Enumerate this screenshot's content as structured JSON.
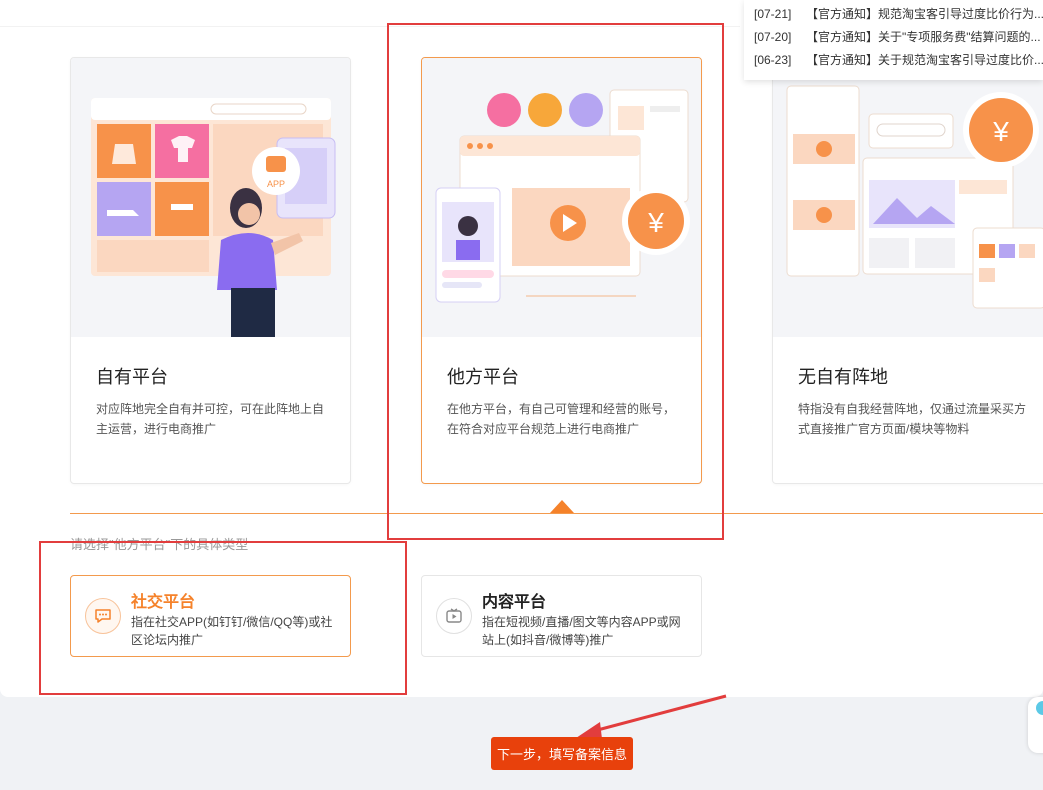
{
  "platforms": [
    {
      "title": "自有平台",
      "desc": "对应阵地完全自有并可控，可在此阵地上自主运营，进行电商推广",
      "selected": false
    },
    {
      "title": "他方平台",
      "desc": "在他方平台，有自己可管理和经营的账号，在符合对应平台规范上进行电商推广",
      "selected": true
    },
    {
      "title": "无自有阵地",
      "desc": "特指没有自我经营阵地，仅通过流量采买方式直接推广官方页面/模块等物料",
      "selected": false
    }
  ],
  "illus": {
    "app_label": "APP",
    "yuan": "¥"
  },
  "subtype": {
    "hint": "请选择\"他方平台\"下的具体类型",
    "options": [
      {
        "title": "社交平台",
        "desc": "指在社交APP(如钉钉/微信/QQ等)或社区论坛内推广",
        "icon": "chat-bubble-icon",
        "selected": true
      },
      {
        "title": "内容平台",
        "desc": "指在短视频/直播/图文等内容APP或网站上(如抖音/微博等)推广",
        "icon": "video-play-icon",
        "selected": false
      }
    ]
  },
  "next_button": "下一步，填写备案信息",
  "news": [
    {
      "date": "[07-21]",
      "text": "【官方通知】规范淘宝客引导过度比价行为..."
    },
    {
      "date": "[07-20]",
      "text": "【官方通知】关于\"专项服务费\"结算问题的..."
    },
    {
      "date": "[06-23]",
      "text": "【官方通知】关于规范淘宝客引导过度比价..."
    }
  ],
  "colors": {
    "accent": "#f5822a",
    "button": "#e8410c",
    "annotation": "#e23d3d"
  }
}
